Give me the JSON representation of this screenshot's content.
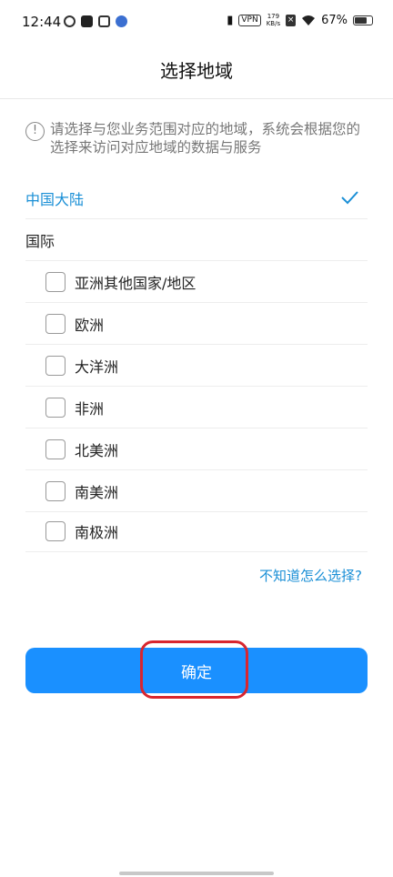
{
  "status_bar": {
    "time": "12:44",
    "vpn": "VPN",
    "speed_value": "179",
    "speed_unit": "KB/s",
    "battery": "67%"
  },
  "page": {
    "title": "选择地域"
  },
  "notice": {
    "icon": "info-icon",
    "text": "请选择与您业务范围对应的地域，系统会根据您的选择来访问对应地域的数据与服务"
  },
  "regions": {
    "mainland": {
      "label": "中国大陆",
      "selected": true
    },
    "international": {
      "label": "国际"
    },
    "sub_regions": [
      {
        "label": "亚洲其他国家/地区",
        "checked": false
      },
      {
        "label": "欧洲",
        "checked": false
      },
      {
        "label": "大洋洲",
        "checked": false
      },
      {
        "label": "非洲",
        "checked": false
      },
      {
        "label": "北美洲",
        "checked": false
      },
      {
        "label": "南美洲",
        "checked": false
      },
      {
        "label": "南极洲",
        "checked": false
      }
    ]
  },
  "help_link": "不知道怎么选择?",
  "confirm_button": "确定",
  "colors": {
    "accent": "#1a8fd6",
    "button": "#1a90ff",
    "highlight": "#d8262f"
  }
}
